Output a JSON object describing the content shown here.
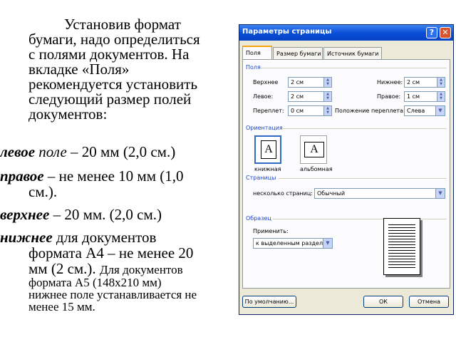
{
  "slide": {
    "intro_1": "Установив формат",
    "intro_2": "бумаги, надо определиться",
    "intro_3": "с полями документов. На",
    "intro_4": "вкладке «Поля»",
    "intro_5": "рекомендуется установить",
    "intro_6": "следующий размер полей",
    "intro_7": "документов:",
    "left_term": "левое",
    "left_term2": "поле",
    "left_rest": " – 20 мм (2,0 см.)",
    "right_term": "правое",
    "right_rest": " – не менее 10 мм (1,0",
    "right_cont": "см.).",
    "top_term": "верхнее",
    "top_rest": " – 20 мм. (2,0 см.)",
    "bottom_term": "нижнее",
    "bottom_rest": " для документов",
    "bottom_cont1": "формата А4 – не менее 20",
    "bottom_cont2a": "мм (2 см.). ",
    "bottom_cont2b": "Для документов",
    "bottom_cont3": "формата А5 (148х210 мм)",
    "bottom_cont4": "нижнее поле устанавливается не",
    "bottom_cont5": "менее 15 мм."
  },
  "dialog": {
    "title": "Параметры страницы",
    "help": "?",
    "close": "✕",
    "tabs": [
      "Поля",
      "Размер бумаги",
      "Источник бумаги"
    ],
    "fields_group": "Поля",
    "top_label": "Верхнее",
    "top_value": "2 см",
    "bottom_label": "Нижнее:",
    "bottom_value": "2 см",
    "left_label": "Левое:",
    "left_value": "2 см",
    "right_label": "Правое:",
    "right_value": "1 см",
    "gutter_label": "Переплет:",
    "gutter_value": "0 см",
    "gutter_pos_label": "Положение переплета:",
    "gutter_pos_value": "Слева",
    "orientation_group": "Ориентация",
    "portrait_label": "книжная",
    "landscape_label": "альбомная",
    "pages_group": "Страницы",
    "multi_pages_label": "несколько страниц:",
    "multi_pages_value": "Обычный",
    "sample_group": "Образец",
    "apply_label": "Применить:",
    "apply_value": "к выделенным раздел",
    "default_button": "По умолчанию...",
    "ok_button": "ОК",
    "cancel_button": "Отмена",
    "icon_letter": "A"
  }
}
